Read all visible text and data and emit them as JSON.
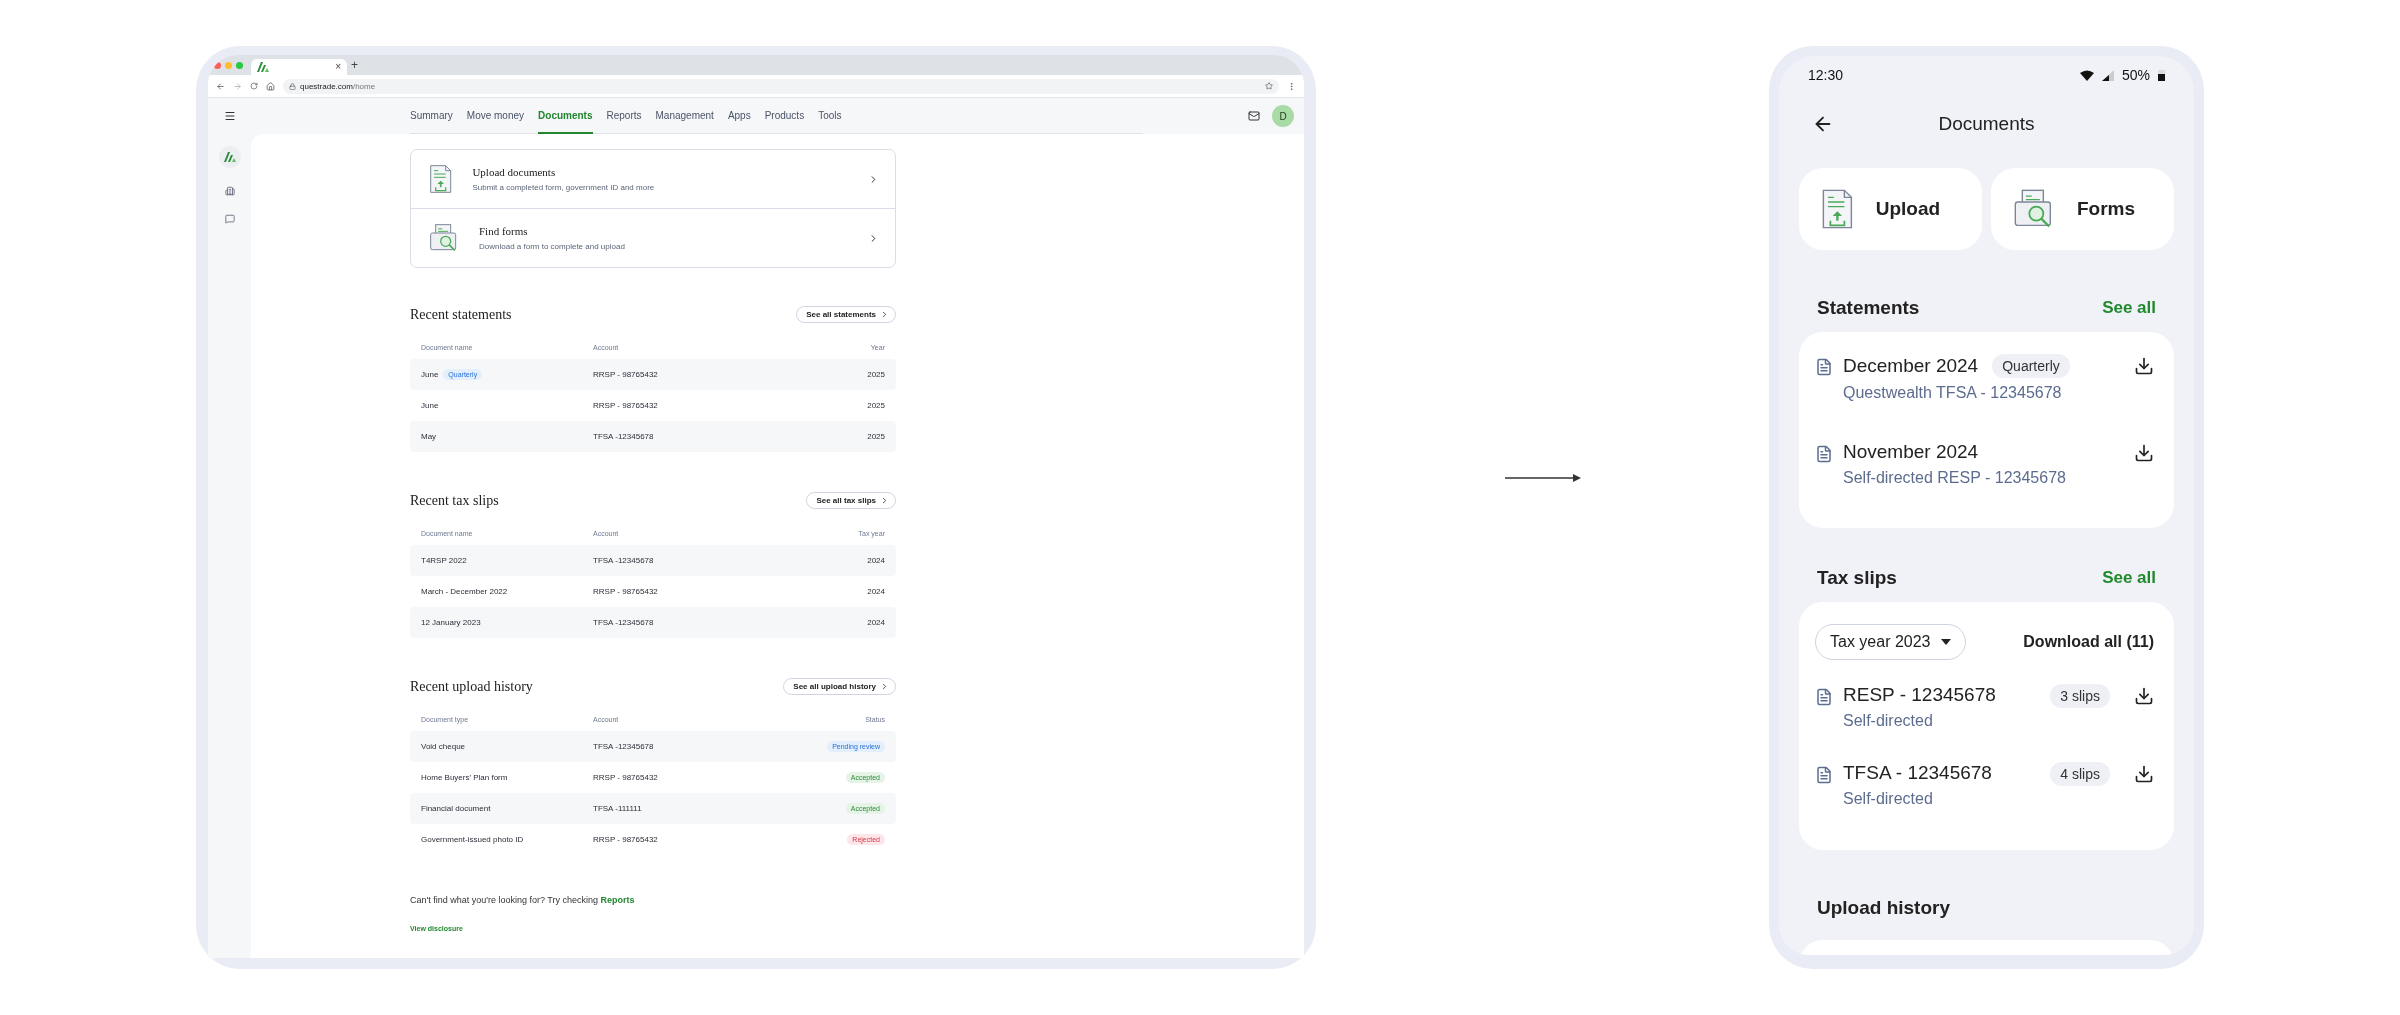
{
  "browser": {
    "tab_close": "×",
    "new_tab": "+",
    "url_host": "questrade.com",
    "url_path": "/home"
  },
  "nav": {
    "items": [
      {
        "label": "Summary",
        "selected": false
      },
      {
        "label": "Move money",
        "selected": false
      },
      {
        "label": "Documents",
        "selected": true
      },
      {
        "label": "Reports",
        "selected": false
      },
      {
        "label": "Management",
        "selected": false
      },
      {
        "label": "Apps",
        "selected": false
      },
      {
        "label": "Products",
        "selected": false
      },
      {
        "label": "Tools",
        "selected": false
      }
    ],
    "avatar": "D"
  },
  "action_cards": [
    {
      "kind": "upload",
      "title": "Upload documents",
      "subtitle": "Submit a completed form, government ID and more"
    },
    {
      "kind": "forms",
      "title": "Find forms",
      "subtitle": "Download a form to complete and upload"
    }
  ],
  "sections": [
    {
      "title": "Recent statements",
      "button": "See all statements",
      "columns": [
        "Document name",
        "Account",
        "Year"
      ],
      "rows": [
        {
          "cells": [
            "June",
            "RRSP - 98765432",
            "2025"
          ],
          "badge": "Quarterly"
        },
        {
          "cells": [
            "June",
            "RRSP - 98765432",
            "2025"
          ]
        },
        {
          "cells": [
            "May",
            "TFSA -12345678",
            "2025"
          ]
        }
      ]
    },
    {
      "title": "Recent tax slips",
      "button": "See all tax slips",
      "columns": [
        "Document name",
        "Account",
        "Tax year"
      ],
      "rows": [
        {
          "cells": [
            "T4RSP 2022",
            "TFSA -12345678",
            "2024"
          ]
        },
        {
          "cells": [
            "March - December 2022",
            "RRSP - 98765432",
            "2024"
          ]
        },
        {
          "cells": [
            "12 January 2023",
            "TFSA -12345678",
            "2024"
          ]
        }
      ]
    },
    {
      "title": "Recent upload history",
      "button": "See all upload history",
      "columns": [
        "Document type",
        "Account",
        "Status"
      ],
      "rows": [
        {
          "cells": [
            "Void cheque",
            "TFSA -12345678"
          ],
          "status": {
            "kind": "pending",
            "label": "Pending review"
          }
        },
        {
          "cells": [
            "Home Buyers' Plan form",
            "RRSP - 98765432"
          ],
          "status": {
            "kind": "accepted",
            "label": "Accepted"
          }
        },
        {
          "cells": [
            "Financial document",
            "TFSA -111111"
          ],
          "status": {
            "kind": "accepted",
            "label": "Accepted"
          }
        },
        {
          "cells": [
            "Government-issued photo ID",
            "RRSP - 98765432"
          ],
          "status": {
            "kind": "rejected",
            "label": "Rejected"
          }
        }
      ]
    }
  ],
  "footer": {
    "text": "Can't find what you're looking for? Try checking ",
    "link": "Reports",
    "disclosure": "View disclosure"
  },
  "phone": {
    "time": "12:30",
    "battery": "50%",
    "title": "Documents",
    "quick_actions": [
      {
        "kind": "upload",
        "label": "Upload"
      },
      {
        "kind": "forms",
        "label": "Forms"
      }
    ],
    "statements": {
      "title": "Statements",
      "see_all": "See all",
      "items": [
        {
          "title": "December 2024",
          "badge": "Quarterly",
          "subtitle": "Questwealth TFSA - 12345678"
        },
        {
          "title": "November 2024",
          "subtitle": "Self-directed RESP - 12345678"
        }
      ]
    },
    "tax_slips": {
      "title": "Tax slips",
      "see_all": "See all",
      "filter": "Tax year 2023",
      "download_all": "Download all (11)",
      "items": [
        {
          "title": "RESP - 12345678",
          "subtitle": "Self-directed",
          "count": "3 slips"
        },
        {
          "title": "TFSA - 12345678",
          "subtitle": "Self-directed",
          "count": "4 slips"
        }
      ]
    },
    "upload_history": {
      "title": "Upload history"
    }
  }
}
